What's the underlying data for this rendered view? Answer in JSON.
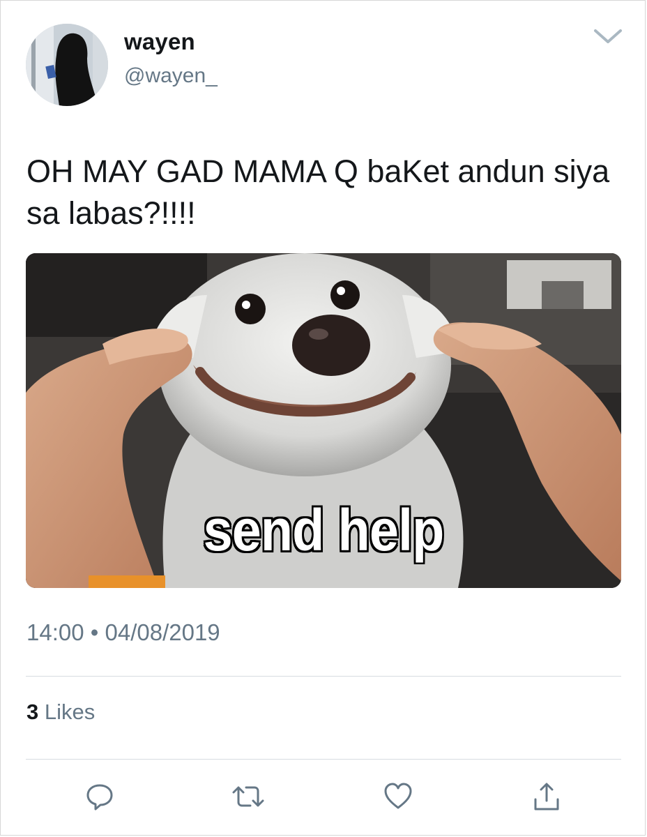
{
  "author": {
    "name": "wayen",
    "handle": "@wayen_"
  },
  "tweet": {
    "text": "OH MAY GAD MAMA Q baKet andun siya sa labas?!!!!"
  },
  "media": {
    "caption": "send help"
  },
  "meta": {
    "time": "14:00",
    "separator": "•",
    "date": "04/08/2019"
  },
  "stats": {
    "likes_count": "3",
    "likes_label": "Likes"
  },
  "icons": {
    "menu": "chevron-down-icon",
    "reply": "reply-icon",
    "retweet": "retweet-icon",
    "like": "heart-icon",
    "share": "share-icon"
  },
  "colors": {
    "text": "#14171a",
    "secondary": "#657786",
    "divider": "#d7dce0",
    "chevron": "#aab8c2"
  }
}
